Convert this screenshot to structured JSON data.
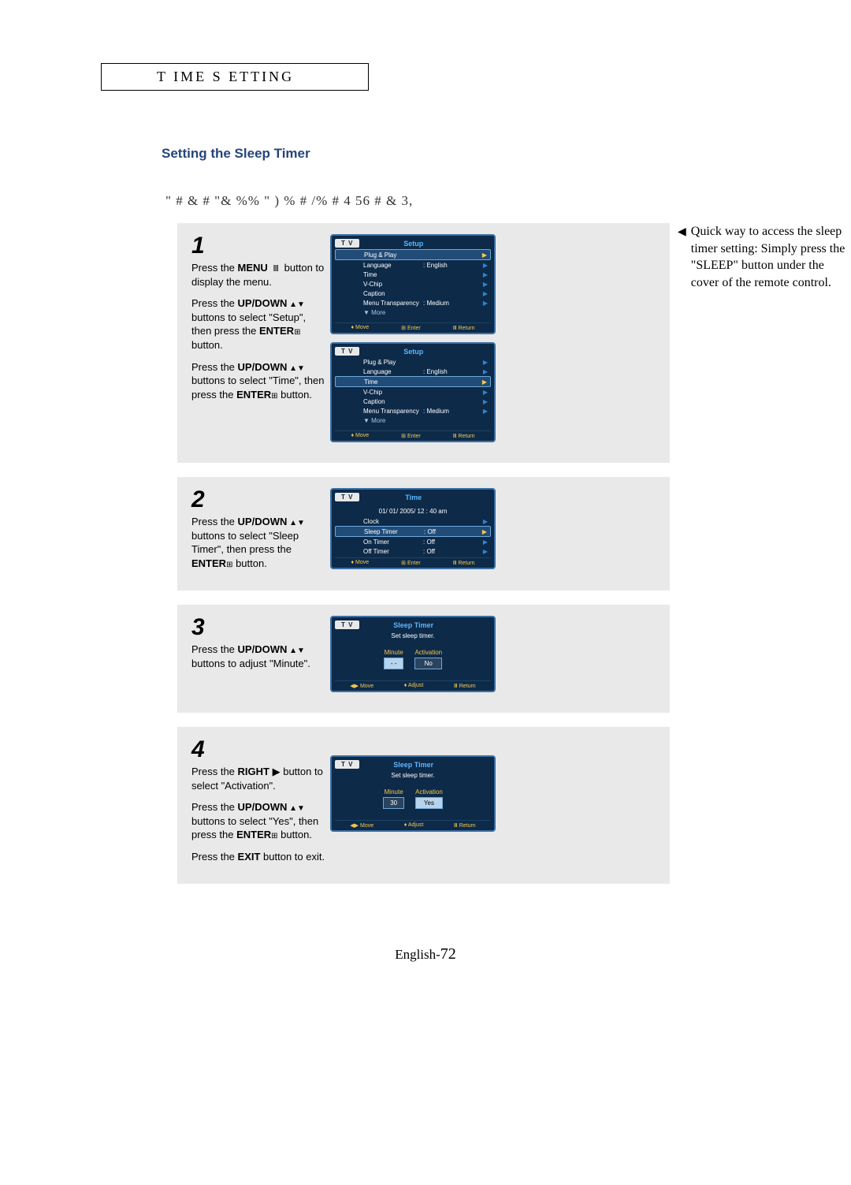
{
  "section_header": "T IME  S ETTING",
  "subheading": "Setting the Sleep Timer",
  "lead_line": "\"     #   & #        \"&   %%  \"  )  %            # /%  # 4    56  #  &   3,",
  "tip": {
    "arrow": "◀",
    "text": "Quick way to access the sleep timer setting: Simply press the \"SLEEP\" button under the cover of the remote control."
  },
  "steps": {
    "s1": {
      "num": "1",
      "p1_a": "Press the ",
      "p1_b": "MENU",
      "p1_icon": " Ⅲ ",
      "p1_c": " button to display the menu.",
      "p2_a": "Press the ",
      "p2_b": "UP/DOWN",
      "p2_icon": " ▲▼",
      "p2_c": " buttons to select \"Setup\", then press the ",
      "p2_d": "ENTER",
      "p2_icon2": "⊞",
      "p2_e": " button.",
      "p3_a": "Press the ",
      "p3_b": "UP/DOWN",
      "p3_icon": " ▲▼",
      "p3_c": " buttons to select \"Time\", then press the ",
      "p3_d": "ENTER",
      "p3_icon2": "⊞",
      "p3_e": "  button."
    },
    "s2": {
      "num": "2",
      "p1_a": "Press the ",
      "p1_b": "UP/DOWN",
      "p1_icon": " ▲▼",
      "p1_c": " buttons to select \"Sleep Timer\", then press the ",
      "p1_d": "ENTER",
      "p1_icon2": "⊞",
      "p1_e": "  button."
    },
    "s3": {
      "num": "3",
      "p1_a": "Press the ",
      "p1_b": "UP/DOWN",
      "p1_icon": " ▲▼",
      "p1_c": " buttons to adjust \"Minute\"."
    },
    "s4": {
      "num": "4",
      "p1_a": "Press the ",
      "p1_b": "RIGHT",
      "p1_icon": " ▶ ",
      "p1_c": " button to select \"Activation\".",
      "p2_a": "Press the ",
      "p2_b": "UP/DOWN",
      "p2_icon": " ▲▼",
      "p2_c": " buttons to select \"Yes\", then press the ",
      "p2_d": "ENTER",
      "p2_icon2": "⊞",
      "p2_e": " button.",
      "p3_a": "Press the ",
      "p3_b": "EXIT",
      "p3_c": " button to exit."
    }
  },
  "osd": {
    "tv": "T V",
    "setup_title": "Setup",
    "time_title": "Time",
    "sleep_title": "Sleep Timer",
    "rows": {
      "plug": "Plug & Play",
      "lang": "Language",
      "lang_val": ": English",
      "time": "Time",
      "vchip": "V-Chip",
      "caption": "Caption",
      "mtrans": "Menu Transparency",
      "mtrans_val": ": Medium",
      "more": "▼ More",
      "clock": "Clock",
      "sleeptimer": "Sleep Timer",
      "sleeptimer_val": ": Off",
      "ontimer": "On Timer",
      "ontimer_val": ": Off",
      "offtimer": "Off Timer",
      "offtimer_val": ": Off",
      "datetime": "01/ 01/ 2005/ 12 : 40 am",
      "setsleep": "Set sleep timer.",
      "minute": "Minute",
      "activation": "Activation",
      "dashes": "- -",
      "no": "No",
      "thirty": "30",
      "yes": "Yes"
    },
    "footer": {
      "move": "♦ Move",
      "enter": "⊞ Enter",
      "return": "Ⅲ Return",
      "move2": "◀▶ Move",
      "adjust": "♦ Adjust"
    }
  },
  "page_num_prefix": "English-",
  "page_num": "72"
}
